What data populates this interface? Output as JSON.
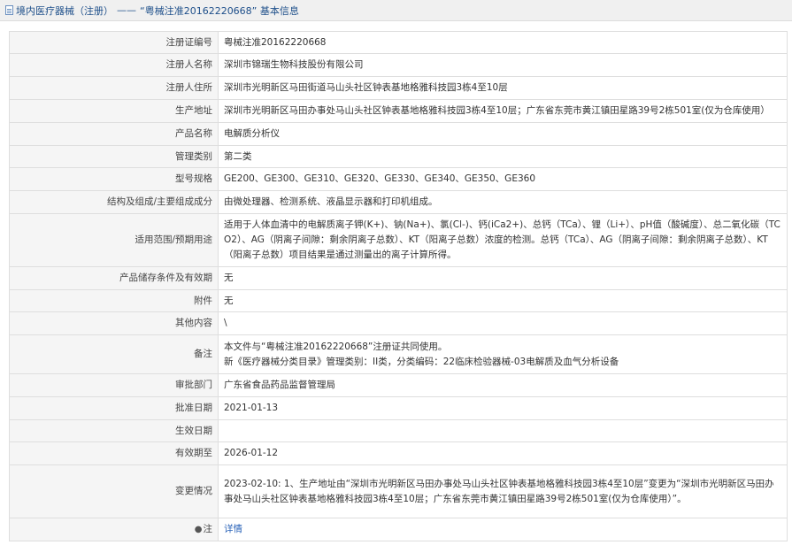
{
  "header": {
    "part1": "境内医疗器械（注册）",
    "separator": "——",
    "part2": "“粤械注准20162220668” 基本信息"
  },
  "rows": [
    {
      "label": "注册证编号",
      "value": "粤械注准20162220668"
    },
    {
      "label": "注册人名称",
      "value": "深圳市锦瑞生物科技股份有限公司"
    },
    {
      "label": "注册人住所",
      "value": "深圳市光明新区马田街道马山头社区钟表基地格雅科技园3栋4至10层"
    },
    {
      "label": "生产地址",
      "value": "深圳市光明新区马田办事处马山头社区钟表基地格雅科技园3栋4至10层；广东省东莞市黄江镇田星路39号2栋501室(仅为仓库使用）"
    },
    {
      "label": "产品名称",
      "value": "电解质分析仪"
    },
    {
      "label": "管理类别",
      "value": "第二类"
    },
    {
      "label": "型号规格",
      "value": "GE200、GE300、GE310、GE320、GE330、GE340、GE350、GE360"
    },
    {
      "label": "结构及组成/主要组成成分",
      "value": "由微处理器、检测系统、液晶显示器和打印机组成。"
    },
    {
      "label": "适用范围/预期用途",
      "value": "适用于人体血清中的电解质离子钾(K+)、钠(Na+)、氯(Cl-)、钙(iCa2+)、总钙（TCa）、锂（Li+）、pH值（酸碱度）、总二氧化碳（TCO2）、AG（阴离子间隙：剩余阴离子总数）、KT（阳离子总数）浓度的检测。总钙（TCa）、AG（阴离子间隙：剩余阴离子总数）、KT（阳离子总数）项目结果是通过测量出的离子计算所得。"
    },
    {
      "label": "产品储存条件及有效期",
      "value": "无"
    },
    {
      "label": "附件",
      "value": "无"
    },
    {
      "label": "其他内容",
      "value": "\\"
    },
    {
      "label": "备注",
      "value_line1": "本文件与“粤械注准20162220668”注册证共同使用。",
      "value_line2": "新《医疗器械分类目录》管理类别：II类，分类编码：22临床检验器械-03电解质及血气分析设备"
    },
    {
      "label": "审批部门",
      "value": "广东省食品药品监督管理局"
    },
    {
      "label": "批准日期",
      "value": "2021-01-13"
    },
    {
      "label": "生效日期",
      "value": ""
    },
    {
      "label": "有效期至",
      "value": "2026-01-12"
    },
    {
      "label": "变更情况",
      "value": "2023-02-10: 1、生产地址由“深圳市光明新区马田办事处马山头社区钟表基地格雅科技园3栋4至10层”变更为“深圳市光明新区马田办事处马山头社区钟表基地格雅科技园3栋4至10层；广东省东莞市黄江镇田星路39号2栋501室(仅为仓库使用）”。"
    },
    {
      "label": "注",
      "icon": "pin-icon",
      "value": "详情"
    }
  ]
}
